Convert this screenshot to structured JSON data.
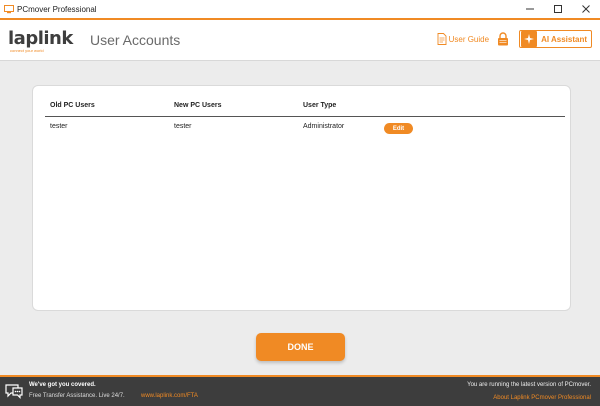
{
  "window": {
    "title": "PCmover Professional",
    "controls": [
      "minimize",
      "maximize",
      "close"
    ]
  },
  "header": {
    "logo_text": "laplink",
    "logo_tagline": "connect your world",
    "page_title": "User Accounts",
    "user_guide_label": "User Guide",
    "ai_assistant_label": "AI Assistant"
  },
  "table": {
    "columns": [
      "Old PC Users",
      "New PC Users",
      "User Type"
    ],
    "rows": [
      {
        "old_user": "tester",
        "new_user": "tester",
        "user_type": "Administrator",
        "action_label": "Edit"
      }
    ]
  },
  "done_label": "DONE",
  "footer": {
    "headline": "We've got you covered.",
    "subline": "Free Transfer Assistance. Live 24/7.",
    "link": "www.laplink.com/FTA",
    "status": "You are running the latest version of PCmover.",
    "about_link": "About Laplink PCmover Professional"
  },
  "colors": {
    "accent": "#f08a24",
    "footer_bg": "#3d3d3d",
    "page_bg": "#ececec"
  }
}
